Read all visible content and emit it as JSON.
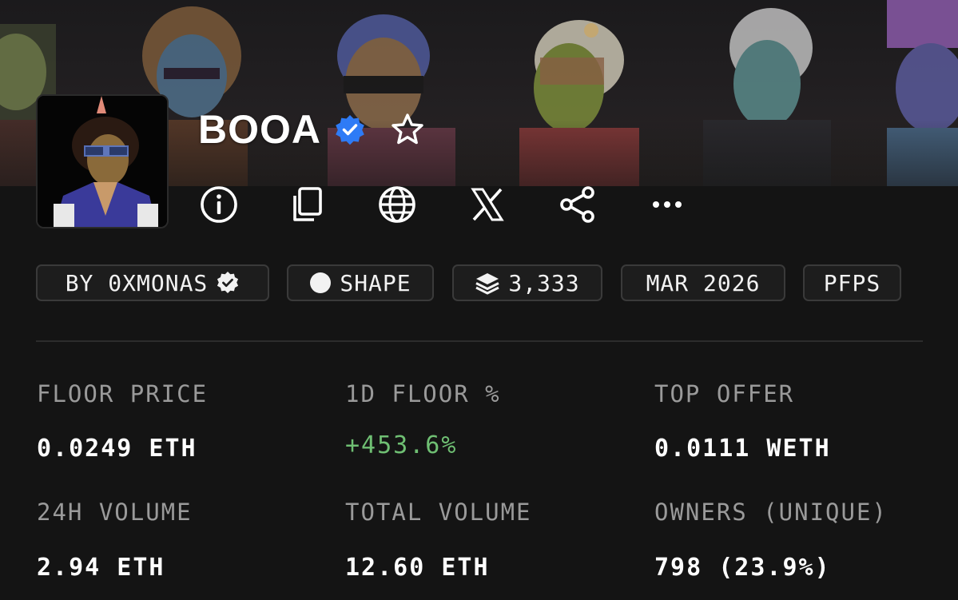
{
  "collection": {
    "title": "BOOA",
    "verified": true,
    "favorited": false
  },
  "actions": [
    {
      "name": "info-icon"
    },
    {
      "name": "copy-icon"
    },
    {
      "name": "globe-icon"
    },
    {
      "name": "x-icon"
    },
    {
      "name": "share-icon"
    },
    {
      "name": "more-icon"
    }
  ],
  "tags": {
    "creator": "BY 0XMONAS",
    "chain": "SHAPE",
    "supply": "3,333",
    "date": "MAR 2026",
    "category": "PFPS"
  },
  "stats": {
    "floor_price": {
      "label": "FLOOR PRICE",
      "value": "0.0249 ETH"
    },
    "floor_change": {
      "label": "1D FLOOR %",
      "value": "+453.6%"
    },
    "top_offer": {
      "label": "TOP OFFER",
      "value": "0.0111 WETH"
    },
    "volume_24h": {
      "label": "24H VOLUME",
      "value": "2.94 ETH"
    },
    "total_volume": {
      "label": "TOTAL VOLUME",
      "value": "12.60 ETH"
    },
    "owners": {
      "label": "OWNERS (UNIQUE)",
      "value": "798 (23.9%)"
    }
  },
  "colors": {
    "background": "#141414",
    "verified_badge": "#2e7bf6",
    "positive_change": "#6fbf73",
    "label_gray": "#9a9a9a"
  }
}
